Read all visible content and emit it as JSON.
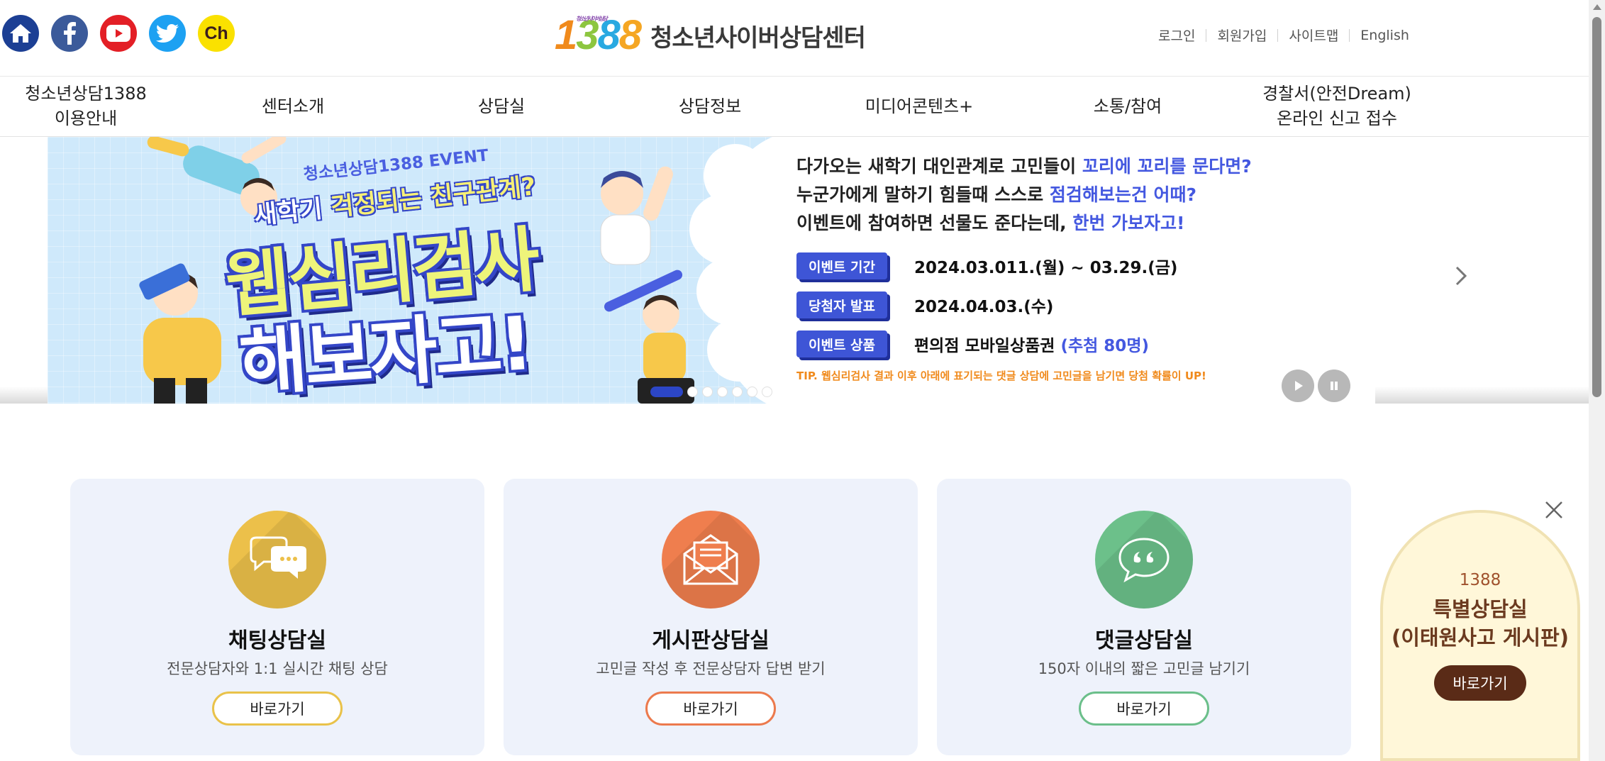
{
  "header": {
    "logo_number": "1388",
    "logo_tagline": "청소년사이버상담",
    "logo_text": "청소년사이버상담센터",
    "social": [
      {
        "name": "home-icon"
      },
      {
        "name": "facebook-icon"
      },
      {
        "name": "youtube-icon"
      },
      {
        "name": "twitter-icon"
      },
      {
        "name": "kakao-channel-icon",
        "label": "Ch"
      }
    ],
    "util_links": [
      "로그인",
      "회원가입",
      "사이트맵",
      "English"
    ]
  },
  "nav": {
    "items": [
      "청소년상담1388\n이용안내",
      "센터소개",
      "상담실",
      "상담정보",
      "미디어콘텐츠+",
      "소통/참여",
      "경찰서(안전Dream)\n온라인 신고 접수"
    ]
  },
  "banner": {
    "event_tag": "청소년상담1388 EVENT",
    "subtitle_pre": "새학기 ",
    "subtitle_em": "걱정되는 친구관계?",
    "title_line1": "웹심리검사",
    "title_line2": "해보자고!",
    "lines": [
      {
        "pre": "다가오는 새학기 대인관계로 고민들이 ",
        "em": "꼬리에 꼬리를 문다면?"
      },
      {
        "pre": "누군가에게 말하기 힘들때 스스로 ",
        "em": "점검해보는건 어때?"
      },
      {
        "pre": "이벤트에 참여하면 선물도 준다는데, ",
        "em": "한번 가보자고!"
      }
    ],
    "rows": [
      {
        "badge": "이벤트 기간",
        "value": "2024.03.011.(월) ~ 03.29.(금)",
        "em": ""
      },
      {
        "badge": "당첨자 발표",
        "value": "2024.04.03.(수)",
        "em": ""
      },
      {
        "badge": "이벤트 상품",
        "value": "편의점 모바일상품권 ",
        "em": "(추첨 80명)"
      }
    ],
    "tip": "TIP. 웹심리검사 결과 이후 아래에 표기되는 댓글 상담에 고민글을 남기면 당첨 확률이 UP!",
    "slide_count": 7,
    "active_slide": 1
  },
  "cards": [
    {
      "title": "채팅상담실",
      "desc": "전문상담자와 1:1 실시간 채팅 상담",
      "button": "바로가기",
      "color": "#ecc04a",
      "border": "#e9c24a",
      "icon": "chat-bubbles-icon"
    },
    {
      "title": "게시판상담실",
      "desc": "고민글 작성 후 전문상담자 답변 받기",
      "button": "바로가기",
      "color": "#ef7e4e",
      "border": "#ec7a4d",
      "icon": "envelope-icon"
    },
    {
      "title": "댓글상담실",
      "desc": "150자 이내의 짧은 고민글 남기기",
      "button": "바로가기",
      "color": "#6cc08a",
      "border": "#6bbf8a",
      "icon": "quote-bubble-icon"
    }
  ],
  "popup": {
    "line1": "1388",
    "line2": "특별상담실",
    "line3": "(이태원사고 게시판)",
    "button": "바로가기"
  },
  "colors": {
    "accent_blue": "#3e55d6",
    "banner_bg": "#cfe9fb",
    "card_bg": "#eef2fb",
    "popup_bg": "#fff7d9",
    "popup_button": "#5a2b17"
  }
}
